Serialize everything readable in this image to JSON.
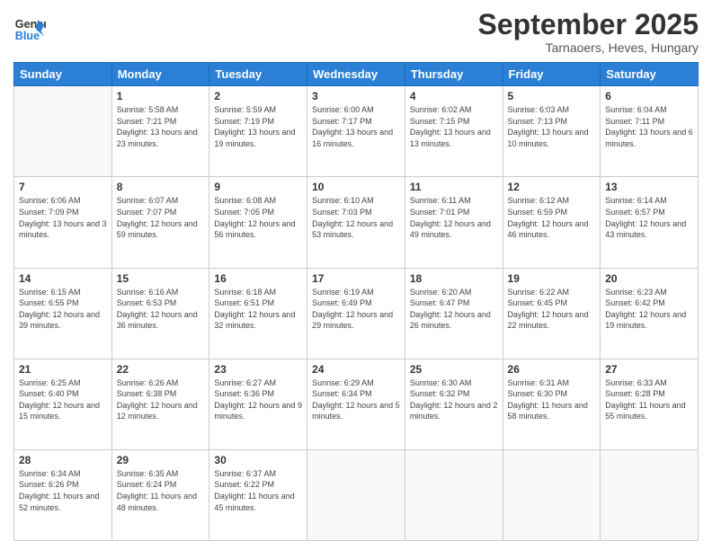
{
  "logo": {
    "line1": "General",
    "line2": "Blue"
  },
  "title": "September 2025",
  "subtitle": "Tarnaoers, Heves, Hungary",
  "days_of_week": [
    "Sunday",
    "Monday",
    "Tuesday",
    "Wednesday",
    "Thursday",
    "Friday",
    "Saturday"
  ],
  "weeks": [
    [
      {
        "day": "",
        "sunrise": "",
        "sunset": "",
        "daylight": ""
      },
      {
        "day": "1",
        "sunrise": "Sunrise: 5:58 AM",
        "sunset": "Sunset: 7:21 PM",
        "daylight": "Daylight: 13 hours and 23 minutes."
      },
      {
        "day": "2",
        "sunrise": "Sunrise: 5:59 AM",
        "sunset": "Sunset: 7:19 PM",
        "daylight": "Daylight: 13 hours and 19 minutes."
      },
      {
        "day": "3",
        "sunrise": "Sunrise: 6:00 AM",
        "sunset": "Sunset: 7:17 PM",
        "daylight": "Daylight: 13 hours and 16 minutes."
      },
      {
        "day": "4",
        "sunrise": "Sunrise: 6:02 AM",
        "sunset": "Sunset: 7:15 PM",
        "daylight": "Daylight: 13 hours and 13 minutes."
      },
      {
        "day": "5",
        "sunrise": "Sunrise: 6:03 AM",
        "sunset": "Sunset: 7:13 PM",
        "daylight": "Daylight: 13 hours and 10 minutes."
      },
      {
        "day": "6",
        "sunrise": "Sunrise: 6:04 AM",
        "sunset": "Sunset: 7:11 PM",
        "daylight": "Daylight: 13 hours and 6 minutes."
      }
    ],
    [
      {
        "day": "7",
        "sunrise": "Sunrise: 6:06 AM",
        "sunset": "Sunset: 7:09 PM",
        "daylight": "Daylight: 13 hours and 3 minutes."
      },
      {
        "day": "8",
        "sunrise": "Sunrise: 6:07 AM",
        "sunset": "Sunset: 7:07 PM",
        "daylight": "Daylight: 12 hours and 59 minutes."
      },
      {
        "day": "9",
        "sunrise": "Sunrise: 6:08 AM",
        "sunset": "Sunset: 7:05 PM",
        "daylight": "Daylight: 12 hours and 56 minutes."
      },
      {
        "day": "10",
        "sunrise": "Sunrise: 6:10 AM",
        "sunset": "Sunset: 7:03 PM",
        "daylight": "Daylight: 12 hours and 53 minutes."
      },
      {
        "day": "11",
        "sunrise": "Sunrise: 6:11 AM",
        "sunset": "Sunset: 7:01 PM",
        "daylight": "Daylight: 12 hours and 49 minutes."
      },
      {
        "day": "12",
        "sunrise": "Sunrise: 6:12 AM",
        "sunset": "Sunset: 6:59 PM",
        "daylight": "Daylight: 12 hours and 46 minutes."
      },
      {
        "day": "13",
        "sunrise": "Sunrise: 6:14 AM",
        "sunset": "Sunset: 6:57 PM",
        "daylight": "Daylight: 12 hours and 43 minutes."
      }
    ],
    [
      {
        "day": "14",
        "sunrise": "Sunrise: 6:15 AM",
        "sunset": "Sunset: 6:55 PM",
        "daylight": "Daylight: 12 hours and 39 minutes."
      },
      {
        "day": "15",
        "sunrise": "Sunrise: 6:16 AM",
        "sunset": "Sunset: 6:53 PM",
        "daylight": "Daylight: 12 hours and 36 minutes."
      },
      {
        "day": "16",
        "sunrise": "Sunrise: 6:18 AM",
        "sunset": "Sunset: 6:51 PM",
        "daylight": "Daylight: 12 hours and 32 minutes."
      },
      {
        "day": "17",
        "sunrise": "Sunrise: 6:19 AM",
        "sunset": "Sunset: 6:49 PM",
        "daylight": "Daylight: 12 hours and 29 minutes."
      },
      {
        "day": "18",
        "sunrise": "Sunrise: 6:20 AM",
        "sunset": "Sunset: 6:47 PM",
        "daylight": "Daylight: 12 hours and 26 minutes."
      },
      {
        "day": "19",
        "sunrise": "Sunrise: 6:22 AM",
        "sunset": "Sunset: 6:45 PM",
        "daylight": "Daylight: 12 hours and 22 minutes."
      },
      {
        "day": "20",
        "sunrise": "Sunrise: 6:23 AM",
        "sunset": "Sunset: 6:42 PM",
        "daylight": "Daylight: 12 hours and 19 minutes."
      }
    ],
    [
      {
        "day": "21",
        "sunrise": "Sunrise: 6:25 AM",
        "sunset": "Sunset: 6:40 PM",
        "daylight": "Daylight: 12 hours and 15 minutes."
      },
      {
        "day": "22",
        "sunrise": "Sunrise: 6:26 AM",
        "sunset": "Sunset: 6:38 PM",
        "daylight": "Daylight: 12 hours and 12 minutes."
      },
      {
        "day": "23",
        "sunrise": "Sunrise: 6:27 AM",
        "sunset": "Sunset: 6:36 PM",
        "daylight": "Daylight: 12 hours and 9 minutes."
      },
      {
        "day": "24",
        "sunrise": "Sunrise: 6:29 AM",
        "sunset": "Sunset: 6:34 PM",
        "daylight": "Daylight: 12 hours and 5 minutes."
      },
      {
        "day": "25",
        "sunrise": "Sunrise: 6:30 AM",
        "sunset": "Sunset: 6:32 PM",
        "daylight": "Daylight: 12 hours and 2 minutes."
      },
      {
        "day": "26",
        "sunrise": "Sunrise: 6:31 AM",
        "sunset": "Sunset: 6:30 PM",
        "daylight": "Daylight: 11 hours and 58 minutes."
      },
      {
        "day": "27",
        "sunrise": "Sunrise: 6:33 AM",
        "sunset": "Sunset: 6:28 PM",
        "daylight": "Daylight: 11 hours and 55 minutes."
      }
    ],
    [
      {
        "day": "28",
        "sunrise": "Sunrise: 6:34 AM",
        "sunset": "Sunset: 6:26 PM",
        "daylight": "Daylight: 11 hours and 52 minutes."
      },
      {
        "day": "29",
        "sunrise": "Sunrise: 6:35 AM",
        "sunset": "Sunset: 6:24 PM",
        "daylight": "Daylight: 11 hours and 48 minutes."
      },
      {
        "day": "30",
        "sunrise": "Sunrise: 6:37 AM",
        "sunset": "Sunset: 6:22 PM",
        "daylight": "Daylight: 11 hours and 45 minutes."
      },
      {
        "day": "",
        "sunrise": "",
        "sunset": "",
        "daylight": ""
      },
      {
        "day": "",
        "sunrise": "",
        "sunset": "",
        "daylight": ""
      },
      {
        "day": "",
        "sunrise": "",
        "sunset": "",
        "daylight": ""
      },
      {
        "day": "",
        "sunrise": "",
        "sunset": "",
        "daylight": ""
      }
    ]
  ]
}
